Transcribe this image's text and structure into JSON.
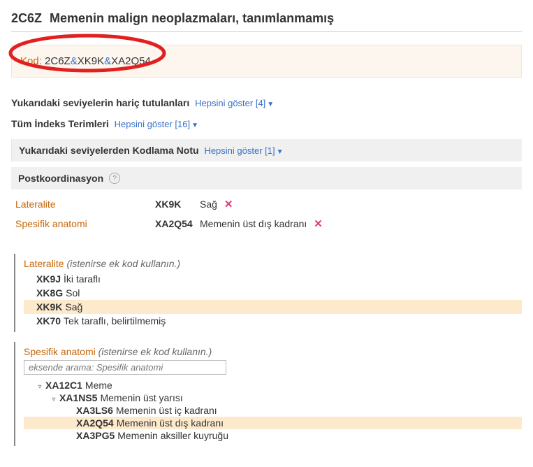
{
  "title": {
    "code": "2C6Z",
    "text": "Memenin malign neoplazmaları, tanımlanmamış"
  },
  "codeBox": {
    "label": "Kod:",
    "parts": [
      "2C6Z",
      "XK9K",
      "XA2Q54"
    ],
    "amp": "&"
  },
  "excl": {
    "label": "Yukarıdaki seviyelerin hariç tutulanları",
    "link": "Hepsini göster [4]"
  },
  "index": {
    "label": "Tüm İndeks Terimleri",
    "link": "Hepsini göster [16]"
  },
  "codingNote": {
    "label": "Yukarıdaki seviyelerden Kodlama Notu",
    "link": "Hepsini göster [1]"
  },
  "postcoord": {
    "label": "Postkoordinasyon",
    "help": "?"
  },
  "selected": [
    {
      "axis": "Lateralite",
      "code": "XK9K",
      "name": "Sağ"
    },
    {
      "axis": "Spesifik anatomi",
      "code": "XA2Q54",
      "name": "Memenin üst dış kadranı"
    }
  ],
  "lateralite": {
    "name": "Lateralite",
    "hint": "(istenirse ek kod kullanın.)",
    "options": [
      {
        "code": "XK9J",
        "name": "İki taraflı",
        "sel": false
      },
      {
        "code": "XK8G",
        "name": "Sol",
        "sel": false
      },
      {
        "code": "XK9K",
        "name": "Sağ",
        "sel": true
      },
      {
        "code": "XK70",
        "name": "Tek taraflı, belirtilmemiş",
        "sel": false
      }
    ]
  },
  "anatomi": {
    "name": "Spesifik anatomi",
    "hint": "(istenirse ek kod kullanın.)",
    "searchPlaceholder": "eksende arama: Spesifik anatomi",
    "tree": [
      {
        "indent": 0,
        "toggle": "▿",
        "code": "XA12C1",
        "name": "Meme",
        "sel": false
      },
      {
        "indent": 1,
        "toggle": "▿",
        "code": "XA1NS5",
        "name": "Memenin üst yarısı",
        "sel": false
      },
      {
        "indent": 2,
        "toggle": "",
        "code": "XA3LS6",
        "name": "Memenin üst iç kadranı",
        "sel": false
      },
      {
        "indent": 2,
        "toggle": "",
        "code": "XA2Q54",
        "name": "Memenin üst dış kadranı",
        "sel": true
      },
      {
        "indent": 2,
        "toggle": "",
        "code": "XA3PG5",
        "name": "Memenin aksiller kuyruğu",
        "sel": false
      }
    ]
  }
}
